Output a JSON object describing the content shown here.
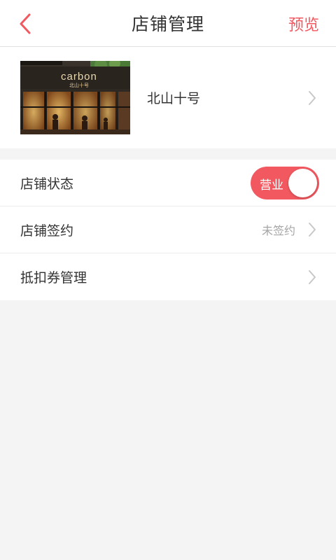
{
  "header": {
    "title": "店铺管理",
    "preview_label": "预览"
  },
  "store": {
    "name": "北山十号",
    "photo_sign_text": "carbon",
    "photo_sign_subtext": "北山十号"
  },
  "settings": {
    "status": {
      "label": "店铺状态",
      "toggle_text": "营业",
      "on": true
    },
    "contract": {
      "label": "店铺签约",
      "value": "未签约"
    },
    "coupon": {
      "label": "抵扣券管理"
    }
  },
  "colors": {
    "accent": "#f2585f",
    "background": "#f4f4f4",
    "muted_text": "#a5a5a5"
  }
}
